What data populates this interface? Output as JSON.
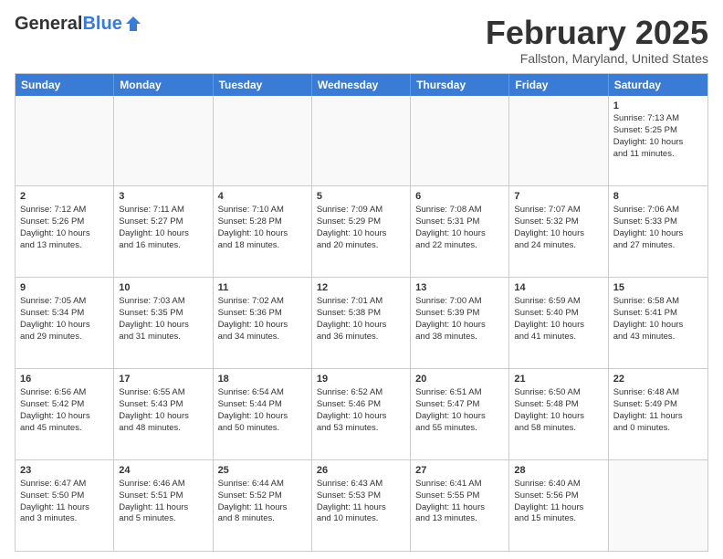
{
  "header": {
    "logo_general": "General",
    "logo_blue": "Blue",
    "month_title": "February 2025",
    "location": "Fallston, Maryland, United States"
  },
  "days_of_week": [
    "Sunday",
    "Monday",
    "Tuesday",
    "Wednesday",
    "Thursday",
    "Friday",
    "Saturday"
  ],
  "weeks": [
    [
      {
        "day": "",
        "info": ""
      },
      {
        "day": "",
        "info": ""
      },
      {
        "day": "",
        "info": ""
      },
      {
        "day": "",
        "info": ""
      },
      {
        "day": "",
        "info": ""
      },
      {
        "day": "",
        "info": ""
      },
      {
        "day": "1",
        "info": "Sunrise: 7:13 AM\nSunset: 5:25 PM\nDaylight: 10 hours\nand 11 minutes."
      }
    ],
    [
      {
        "day": "2",
        "info": "Sunrise: 7:12 AM\nSunset: 5:26 PM\nDaylight: 10 hours\nand 13 minutes."
      },
      {
        "day": "3",
        "info": "Sunrise: 7:11 AM\nSunset: 5:27 PM\nDaylight: 10 hours\nand 16 minutes."
      },
      {
        "day": "4",
        "info": "Sunrise: 7:10 AM\nSunset: 5:28 PM\nDaylight: 10 hours\nand 18 minutes."
      },
      {
        "day": "5",
        "info": "Sunrise: 7:09 AM\nSunset: 5:29 PM\nDaylight: 10 hours\nand 20 minutes."
      },
      {
        "day": "6",
        "info": "Sunrise: 7:08 AM\nSunset: 5:31 PM\nDaylight: 10 hours\nand 22 minutes."
      },
      {
        "day": "7",
        "info": "Sunrise: 7:07 AM\nSunset: 5:32 PM\nDaylight: 10 hours\nand 24 minutes."
      },
      {
        "day": "8",
        "info": "Sunrise: 7:06 AM\nSunset: 5:33 PM\nDaylight: 10 hours\nand 27 minutes."
      }
    ],
    [
      {
        "day": "9",
        "info": "Sunrise: 7:05 AM\nSunset: 5:34 PM\nDaylight: 10 hours\nand 29 minutes."
      },
      {
        "day": "10",
        "info": "Sunrise: 7:03 AM\nSunset: 5:35 PM\nDaylight: 10 hours\nand 31 minutes."
      },
      {
        "day": "11",
        "info": "Sunrise: 7:02 AM\nSunset: 5:36 PM\nDaylight: 10 hours\nand 34 minutes."
      },
      {
        "day": "12",
        "info": "Sunrise: 7:01 AM\nSunset: 5:38 PM\nDaylight: 10 hours\nand 36 minutes."
      },
      {
        "day": "13",
        "info": "Sunrise: 7:00 AM\nSunset: 5:39 PM\nDaylight: 10 hours\nand 38 minutes."
      },
      {
        "day": "14",
        "info": "Sunrise: 6:59 AM\nSunset: 5:40 PM\nDaylight: 10 hours\nand 41 minutes."
      },
      {
        "day": "15",
        "info": "Sunrise: 6:58 AM\nSunset: 5:41 PM\nDaylight: 10 hours\nand 43 minutes."
      }
    ],
    [
      {
        "day": "16",
        "info": "Sunrise: 6:56 AM\nSunset: 5:42 PM\nDaylight: 10 hours\nand 45 minutes."
      },
      {
        "day": "17",
        "info": "Sunrise: 6:55 AM\nSunset: 5:43 PM\nDaylight: 10 hours\nand 48 minutes."
      },
      {
        "day": "18",
        "info": "Sunrise: 6:54 AM\nSunset: 5:44 PM\nDaylight: 10 hours\nand 50 minutes."
      },
      {
        "day": "19",
        "info": "Sunrise: 6:52 AM\nSunset: 5:46 PM\nDaylight: 10 hours\nand 53 minutes."
      },
      {
        "day": "20",
        "info": "Sunrise: 6:51 AM\nSunset: 5:47 PM\nDaylight: 10 hours\nand 55 minutes."
      },
      {
        "day": "21",
        "info": "Sunrise: 6:50 AM\nSunset: 5:48 PM\nDaylight: 10 hours\nand 58 minutes."
      },
      {
        "day": "22",
        "info": "Sunrise: 6:48 AM\nSunset: 5:49 PM\nDaylight: 11 hours\nand 0 minutes."
      }
    ],
    [
      {
        "day": "23",
        "info": "Sunrise: 6:47 AM\nSunset: 5:50 PM\nDaylight: 11 hours\nand 3 minutes."
      },
      {
        "day": "24",
        "info": "Sunrise: 6:46 AM\nSunset: 5:51 PM\nDaylight: 11 hours\nand 5 minutes."
      },
      {
        "day": "25",
        "info": "Sunrise: 6:44 AM\nSunset: 5:52 PM\nDaylight: 11 hours\nand 8 minutes."
      },
      {
        "day": "26",
        "info": "Sunrise: 6:43 AM\nSunset: 5:53 PM\nDaylight: 11 hours\nand 10 minutes."
      },
      {
        "day": "27",
        "info": "Sunrise: 6:41 AM\nSunset: 5:55 PM\nDaylight: 11 hours\nand 13 minutes."
      },
      {
        "day": "28",
        "info": "Sunrise: 6:40 AM\nSunset: 5:56 PM\nDaylight: 11 hours\nand 15 minutes."
      },
      {
        "day": "",
        "info": ""
      }
    ]
  ]
}
